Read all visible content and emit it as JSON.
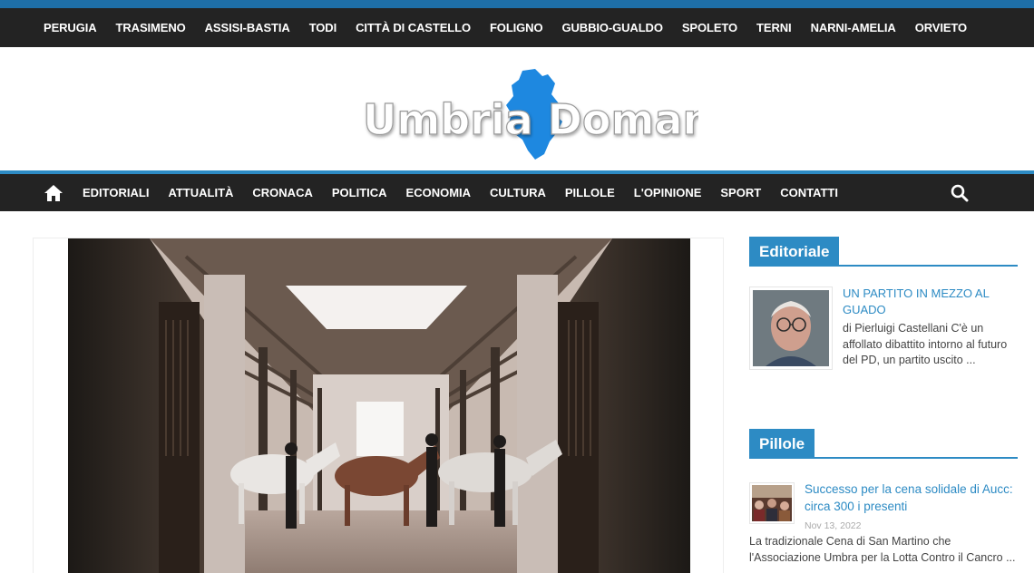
{
  "top_nav": [
    "PERUGIA",
    "TRASIMENO",
    "ASSISI-BASTIA",
    "TODI",
    "CITTÀ DI CASTELLO",
    "FOLIGNO",
    "GUBBIO-GUALDO",
    "SPOLETO",
    "TERNI",
    "NARNI-AMELIA",
    "ORVIETO"
  ],
  "logo": {
    "text": "Umbria Domani",
    "brand_color": "#2d8bc4"
  },
  "main_nav": [
    "EDITORIALI",
    "ATTUALITÀ",
    "CRONACA",
    "POLITICA",
    "ECONOMIA",
    "CULTURA",
    "PILLOLE",
    "L'OPINIONE",
    "SPORT",
    "CONTATTI"
  ],
  "icons": {
    "home": "home-icon",
    "search": "search-icon"
  },
  "editoriale": {
    "heading": "Editoriale",
    "title": "UN PARTITO IN MEZZO AL GUADO",
    "excerpt": "di Pierluigi Castellani C'è un affollato dibattito intorno al futuro del PD, un partito uscito ..."
  },
  "pillole": {
    "heading": "Pillole",
    "title": "Successo per la cena solidale di Aucc: circa 300 i presenti",
    "date": "Nov 13, 2022",
    "excerpt": "La tradizionale Cena di San Martino che l'Associazione Umbra per la Lotta Contro il Cancro ..."
  },
  "colors": {
    "nav_bg": "#232323",
    "accent": "#2d8bc4"
  }
}
